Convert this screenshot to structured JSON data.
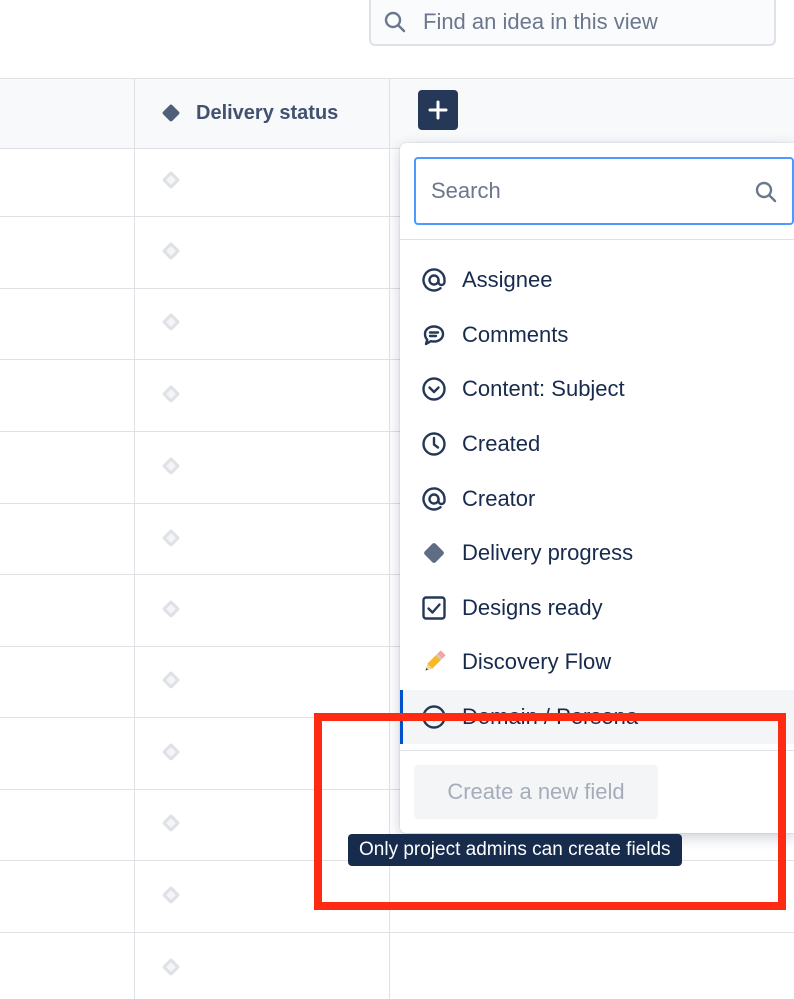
{
  "top_search": {
    "placeholder": "Find an idea in this view"
  },
  "table": {
    "column_header": "Delivery status",
    "add_column_label": "+"
  },
  "field_picker": {
    "search_placeholder": "Search",
    "items": [
      {
        "label": "Assignee",
        "icon": "at-icon"
      },
      {
        "label": "Comments",
        "icon": "comment-icon"
      },
      {
        "label": "Content: Subject",
        "icon": "chevron-circle-icon"
      },
      {
        "label": "Created",
        "icon": "clock-icon"
      },
      {
        "label": "Creator",
        "icon": "at-icon"
      },
      {
        "label": "Delivery progress",
        "icon": "diamond-icon"
      },
      {
        "label": "Designs ready",
        "icon": "checkbox-icon"
      },
      {
        "label": "Discovery Flow",
        "icon": "pencil-emoji-icon"
      },
      {
        "label": "Domain / Persona",
        "icon": "chevron-circle-icon"
      }
    ],
    "create_button_label": "Create a new field"
  },
  "tooltip": {
    "text": "Only project admins can create fields"
  },
  "colors": {
    "accent": "#0052cc",
    "header_button": "#253858",
    "highlight": "#ff2a12",
    "tooltip_bg": "#172b4d",
    "search_focus": "#4c9aff"
  }
}
